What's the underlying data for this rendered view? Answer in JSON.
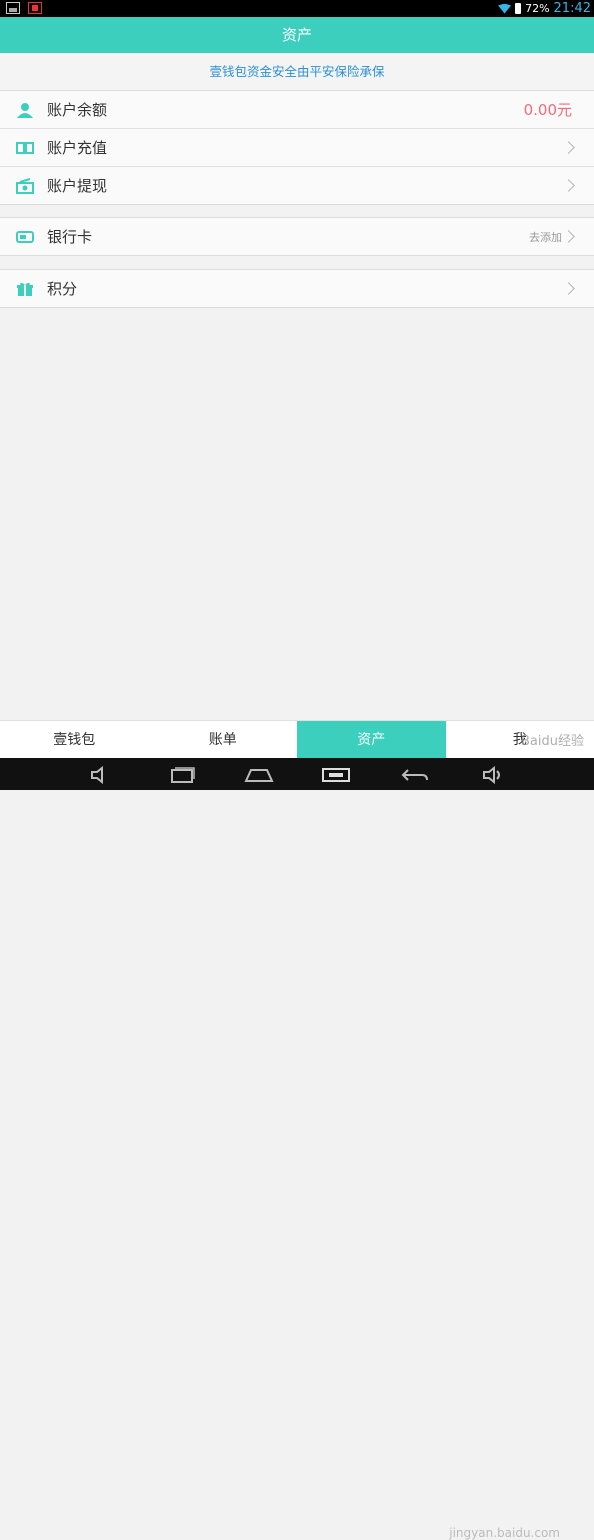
{
  "status_bar": {
    "battery": "72%",
    "time": "21:42"
  },
  "header": {
    "title": "资产"
  },
  "notice": "壹钱包资金安全由平安保险承保",
  "group1": [
    {
      "label": "账户余额",
      "value": "0.00元",
      "icon": "user-icon"
    },
    {
      "label": "账户充值",
      "icon": "recharge-icon"
    },
    {
      "label": "账户提现",
      "icon": "withdraw-icon"
    }
  ],
  "group2": [
    {
      "label": "银行卡",
      "hint": "去添加",
      "icon": "bank-card-icon"
    }
  ],
  "group3": [
    {
      "label": "积分",
      "icon": "gift-icon"
    }
  ],
  "tabs": [
    "壹钱包",
    "账单",
    "资产",
    "我"
  ],
  "active_tab": "资产",
  "watermark": {
    "brand": "Baidu经验",
    "url": "jingyan.baidu.com"
  },
  "colors": {
    "accent": "#3ccfbe",
    "value": "#f06b7c",
    "notice": "#2a8fd6"
  }
}
